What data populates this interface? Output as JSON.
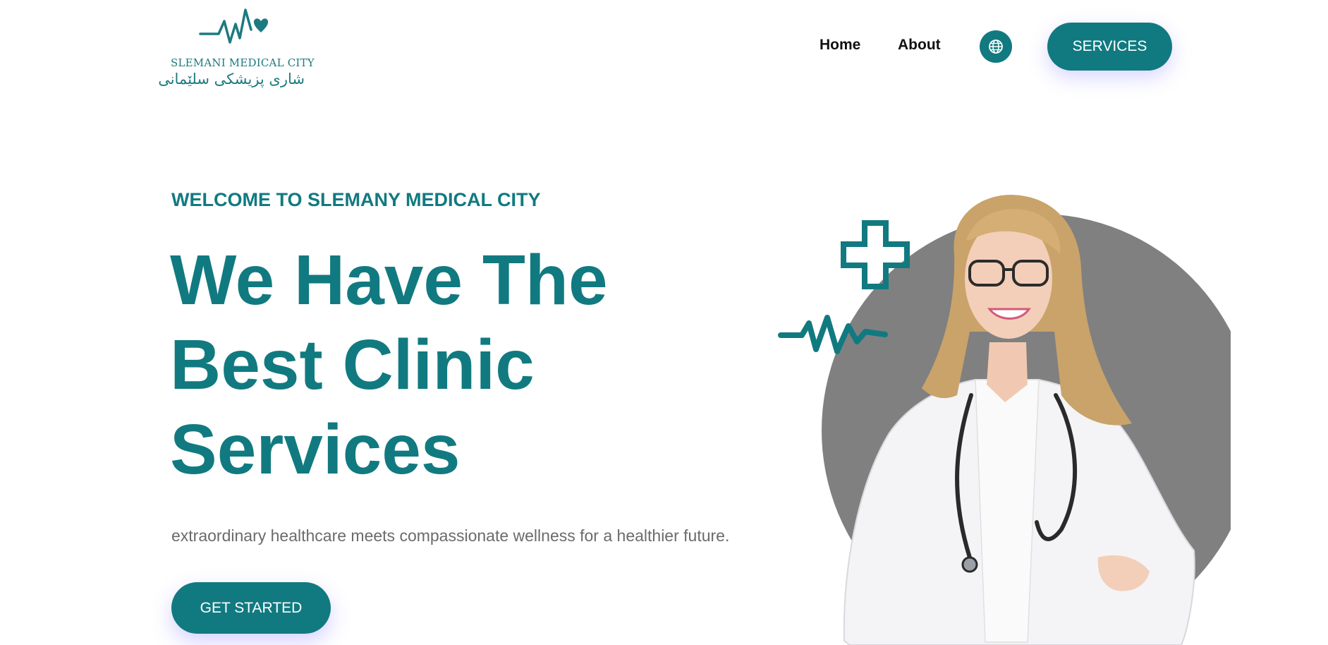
{
  "brand": {
    "name_en": "SLEMANI MEDICAL CITY",
    "name_ku": "شاری پزیشکی سلێمانی"
  },
  "nav": {
    "home": "Home",
    "about": "About",
    "language_icon": "globe-icon",
    "services_label": "SERVICES"
  },
  "hero": {
    "welcome": "WELCOME TO SLEMANY MEDICAL CITY",
    "headline_lines": [
      "We Have The",
      "Best Clinic",
      "Services"
    ],
    "tagline": "extraordinary healthcare meets compassionate wellness for a healthier future.",
    "cta_label": "GET STARTED"
  },
  "colors": {
    "primary": "#117a80",
    "text_dark": "#111111",
    "text_muted": "#6b6b6b",
    "image_backdrop": "#808080"
  }
}
